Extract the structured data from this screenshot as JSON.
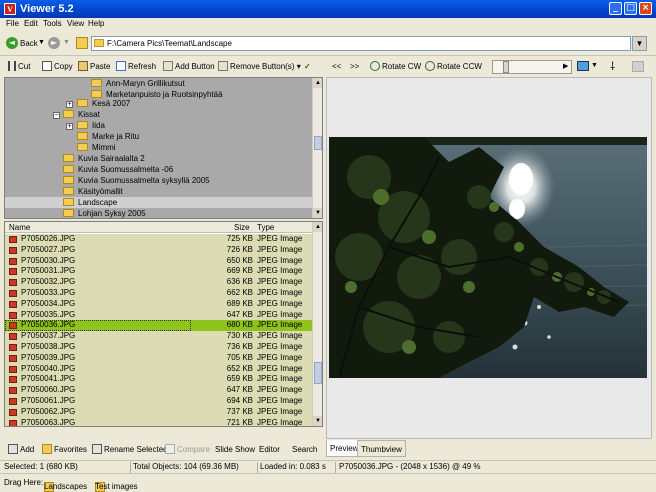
{
  "window": {
    "title": "Viewer 5.2",
    "app_icon": "V"
  },
  "menu": [
    "File",
    "Edit",
    "Tools",
    "View",
    "Help"
  ],
  "nav": {
    "back_label": "Back",
    "path": "F:\\Camera Pics\\Teemat\\Landscape"
  },
  "toolbar": {
    "cut": "Cut",
    "copy": "Copy",
    "paste": "Paste",
    "refresh": "Refresh",
    "add_button": "Add Button",
    "remove_buttons": "Remove Button(s)"
  },
  "viewer_toolbar": {
    "prev": "<<",
    "next": ">>",
    "rotate_cw": "Rotate CW",
    "rotate_ccw": "Rotate CCW"
  },
  "tree": [
    {
      "label": "Ann-Maryn Grillikutsut",
      "level": 3
    },
    {
      "label": "Marketanpuisto ja Ruotsinpyhtää",
      "level": 3
    },
    {
      "label": "Kesä 2007",
      "level": 2
    },
    {
      "label": "Kissat",
      "level": 1
    },
    {
      "label": "Iida",
      "level": 2
    },
    {
      "label": "Marke ja Ritu",
      "level": 2
    },
    {
      "label": "Mimmi",
      "level": 2
    },
    {
      "label": "Kuvia Sairaalalta 2",
      "level": 1
    },
    {
      "label": "Kuvia Suomussalmelta -06",
      "level": 1
    },
    {
      "label": "Kuvia Suomussalmelta syksyllä 2005",
      "level": 1
    },
    {
      "label": "Käsityömallit",
      "level": 1
    },
    {
      "label": "Landscape",
      "level": 1
    },
    {
      "label": "Lohjan Syksy 2005",
      "level": 1
    }
  ],
  "file_list": {
    "headers": {
      "name": "Name",
      "size": "Size",
      "type": "Type"
    },
    "rows": [
      {
        "name": "P7050026.JPG",
        "size": "725 KB",
        "type": "JPEG Image"
      },
      {
        "name": "P7050027.JPG",
        "size": "726 KB",
        "type": "JPEG Image"
      },
      {
        "name": "P7050030.JPG",
        "size": "650 KB",
        "type": "JPEG Image"
      },
      {
        "name": "P7050031.JPG",
        "size": "669 KB",
        "type": "JPEG Image"
      },
      {
        "name": "P7050032.JPG",
        "size": "636 KB",
        "type": "JPEG Image"
      },
      {
        "name": "P7050033.JPG",
        "size": "662 KB",
        "type": "JPEG Image"
      },
      {
        "name": "P7050034.JPG",
        "size": "689 KB",
        "type": "JPEG Image"
      },
      {
        "name": "P7050035.JPG",
        "size": "647 KB",
        "type": "JPEG Image"
      },
      {
        "name": "P7050036.JPG",
        "size": "680 KB",
        "type": "JPEG Image",
        "selected": true
      },
      {
        "name": "P7050037.JPG",
        "size": "730 KB",
        "type": "JPEG Image"
      },
      {
        "name": "P7050038.JPG",
        "size": "736 KB",
        "type": "JPEG Image"
      },
      {
        "name": "P7050039.JPG",
        "size": "705 KB",
        "type": "JPEG Image"
      },
      {
        "name": "P7050040.JPG",
        "size": "652 KB",
        "type": "JPEG Image"
      },
      {
        "name": "P7050041.JPG",
        "size": "659 KB",
        "type": "JPEG Image"
      },
      {
        "name": "P7050060.JPG",
        "size": "647 KB",
        "type": "JPEG Image"
      },
      {
        "name": "P7050061.JPG",
        "size": "694 KB",
        "type": "JPEG Image"
      },
      {
        "name": "P7050062.JPG",
        "size": "737 KB",
        "type": "JPEG Image"
      },
      {
        "name": "P7050063.JPG",
        "size": "721 KB",
        "type": "JPEG Image"
      }
    ]
  },
  "actions": {
    "add": "Add",
    "favorites": "Favorites",
    "rename": "Rename Selected",
    "compare": "Compare",
    "slide_show": "Slide Show",
    "editor": "Editor",
    "search": "Search"
  },
  "tabs": {
    "preview": "Preview",
    "thumbview": "Thumbview"
  },
  "status": {
    "selected": "Selected: 1 (680 KB)",
    "total": "Total Objects: 104 (69.36 MB)",
    "loaded": "Loaded in: 0.083 s",
    "image_info": "P7050036.JPG - (2048 x 1536) @ 49  %"
  },
  "drag": {
    "label": "Drag Here:",
    "items": [
      "Landscapes",
      "Test images"
    ]
  },
  "colors": {
    "titlebar": "#0a5ee8",
    "selection_green": "#8ec21c",
    "list_bg": "#dcdcb4",
    "tree_bg": "#a9a9a9"
  }
}
